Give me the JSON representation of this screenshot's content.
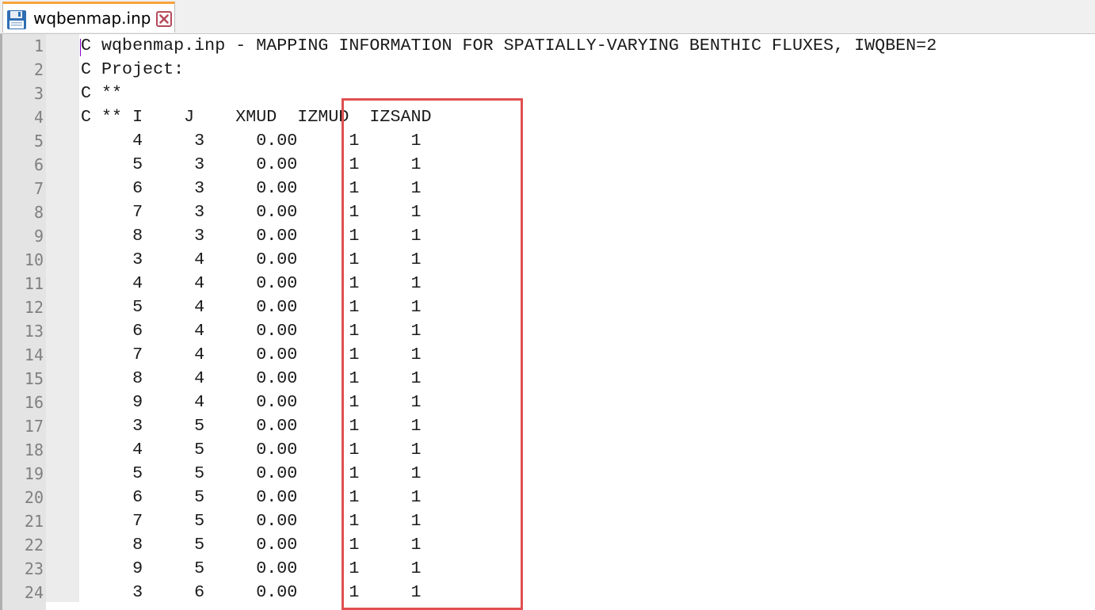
{
  "tab": {
    "title": "wqbenmap.inp",
    "icon": "save-icon",
    "close_icon": "close-icon",
    "accent": "#f6a33a"
  },
  "editor": {
    "lines": [
      {
        "num": "1",
        "text": "C wqbenmap.inp - MAPPING INFORMATION FOR SPATIALLY-VARYING BENTHIC FLUXES, IWQBEN=2"
      },
      {
        "num": "2",
        "text": "C Project:"
      },
      {
        "num": "3",
        "text": "C **"
      },
      {
        "num": "4",
        "text": "C ** I    J    XMUD  IZMUD  IZSAND"
      },
      {
        "num": "5",
        "text": "     4     3     0.00     1     1"
      },
      {
        "num": "6",
        "text": "     5     3     0.00     1     1"
      },
      {
        "num": "7",
        "text": "     6     3     0.00     1     1"
      },
      {
        "num": "8",
        "text": "     7     3     0.00     1     1"
      },
      {
        "num": "9",
        "text": "     8     3     0.00     1     1"
      },
      {
        "num": "10",
        "text": "     3     4     0.00     1     1"
      },
      {
        "num": "11",
        "text": "     4     4     0.00     1     1"
      },
      {
        "num": "12",
        "text": "     5     4     0.00     1     1"
      },
      {
        "num": "13",
        "text": "     6     4     0.00     1     1"
      },
      {
        "num": "14",
        "text": "     7     4     0.00     1     1"
      },
      {
        "num": "15",
        "text": "     8     4     0.00     1     1"
      },
      {
        "num": "16",
        "text": "     9     4     0.00     1     1"
      },
      {
        "num": "17",
        "text": "     3     5     0.00     1     1"
      },
      {
        "num": "18",
        "text": "     4     5     0.00     1     1"
      },
      {
        "num": "19",
        "text": "     5     5     0.00     1     1"
      },
      {
        "num": "20",
        "text": "     6     5     0.00     1     1"
      },
      {
        "num": "21",
        "text": "     7     5     0.00     1     1"
      },
      {
        "num": "22",
        "text": "     8     5     0.00     1     1"
      },
      {
        "num": "23",
        "text": "     9     5     0.00     1     1"
      },
      {
        "num": "24",
        "text": "     3     6     0.00     1     1"
      }
    ],
    "highlight_color": "#e05050"
  }
}
